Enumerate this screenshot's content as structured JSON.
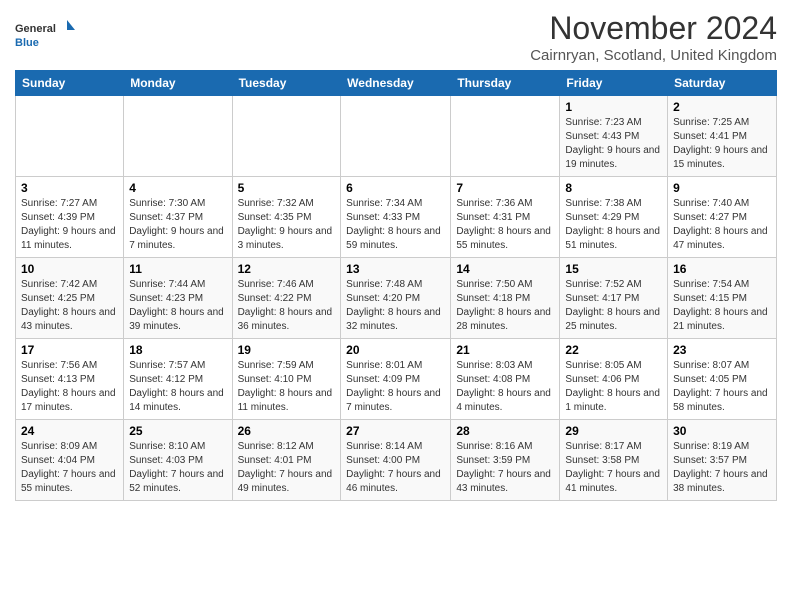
{
  "header": {
    "logo_line1": "General",
    "logo_line2": "Blue",
    "title": "November 2024",
    "subtitle": "Cairnryan, Scotland, United Kingdom"
  },
  "days_of_week": [
    "Sunday",
    "Monday",
    "Tuesday",
    "Wednesday",
    "Thursday",
    "Friday",
    "Saturday"
  ],
  "weeks": [
    [
      {
        "day": "",
        "info": ""
      },
      {
        "day": "",
        "info": ""
      },
      {
        "day": "",
        "info": ""
      },
      {
        "day": "",
        "info": ""
      },
      {
        "day": "",
        "info": ""
      },
      {
        "day": "1",
        "info": "Sunrise: 7:23 AM\nSunset: 4:43 PM\nDaylight: 9 hours and 19 minutes."
      },
      {
        "day": "2",
        "info": "Sunrise: 7:25 AM\nSunset: 4:41 PM\nDaylight: 9 hours and 15 minutes."
      }
    ],
    [
      {
        "day": "3",
        "info": "Sunrise: 7:27 AM\nSunset: 4:39 PM\nDaylight: 9 hours and 11 minutes."
      },
      {
        "day": "4",
        "info": "Sunrise: 7:30 AM\nSunset: 4:37 PM\nDaylight: 9 hours and 7 minutes."
      },
      {
        "day": "5",
        "info": "Sunrise: 7:32 AM\nSunset: 4:35 PM\nDaylight: 9 hours and 3 minutes."
      },
      {
        "day": "6",
        "info": "Sunrise: 7:34 AM\nSunset: 4:33 PM\nDaylight: 8 hours and 59 minutes."
      },
      {
        "day": "7",
        "info": "Sunrise: 7:36 AM\nSunset: 4:31 PM\nDaylight: 8 hours and 55 minutes."
      },
      {
        "day": "8",
        "info": "Sunrise: 7:38 AM\nSunset: 4:29 PM\nDaylight: 8 hours and 51 minutes."
      },
      {
        "day": "9",
        "info": "Sunrise: 7:40 AM\nSunset: 4:27 PM\nDaylight: 8 hours and 47 minutes."
      }
    ],
    [
      {
        "day": "10",
        "info": "Sunrise: 7:42 AM\nSunset: 4:25 PM\nDaylight: 8 hours and 43 minutes."
      },
      {
        "day": "11",
        "info": "Sunrise: 7:44 AM\nSunset: 4:23 PM\nDaylight: 8 hours and 39 minutes."
      },
      {
        "day": "12",
        "info": "Sunrise: 7:46 AM\nSunset: 4:22 PM\nDaylight: 8 hours and 36 minutes."
      },
      {
        "day": "13",
        "info": "Sunrise: 7:48 AM\nSunset: 4:20 PM\nDaylight: 8 hours and 32 minutes."
      },
      {
        "day": "14",
        "info": "Sunrise: 7:50 AM\nSunset: 4:18 PM\nDaylight: 8 hours and 28 minutes."
      },
      {
        "day": "15",
        "info": "Sunrise: 7:52 AM\nSunset: 4:17 PM\nDaylight: 8 hours and 25 minutes."
      },
      {
        "day": "16",
        "info": "Sunrise: 7:54 AM\nSunset: 4:15 PM\nDaylight: 8 hours and 21 minutes."
      }
    ],
    [
      {
        "day": "17",
        "info": "Sunrise: 7:56 AM\nSunset: 4:13 PM\nDaylight: 8 hours and 17 minutes."
      },
      {
        "day": "18",
        "info": "Sunrise: 7:57 AM\nSunset: 4:12 PM\nDaylight: 8 hours and 14 minutes."
      },
      {
        "day": "19",
        "info": "Sunrise: 7:59 AM\nSunset: 4:10 PM\nDaylight: 8 hours and 11 minutes."
      },
      {
        "day": "20",
        "info": "Sunrise: 8:01 AM\nSunset: 4:09 PM\nDaylight: 8 hours and 7 minutes."
      },
      {
        "day": "21",
        "info": "Sunrise: 8:03 AM\nSunset: 4:08 PM\nDaylight: 8 hours and 4 minutes."
      },
      {
        "day": "22",
        "info": "Sunrise: 8:05 AM\nSunset: 4:06 PM\nDaylight: 8 hours and 1 minute."
      },
      {
        "day": "23",
        "info": "Sunrise: 8:07 AM\nSunset: 4:05 PM\nDaylight: 7 hours and 58 minutes."
      }
    ],
    [
      {
        "day": "24",
        "info": "Sunrise: 8:09 AM\nSunset: 4:04 PM\nDaylight: 7 hours and 55 minutes."
      },
      {
        "day": "25",
        "info": "Sunrise: 8:10 AM\nSunset: 4:03 PM\nDaylight: 7 hours and 52 minutes."
      },
      {
        "day": "26",
        "info": "Sunrise: 8:12 AM\nSunset: 4:01 PM\nDaylight: 7 hours and 49 minutes."
      },
      {
        "day": "27",
        "info": "Sunrise: 8:14 AM\nSunset: 4:00 PM\nDaylight: 7 hours and 46 minutes."
      },
      {
        "day": "28",
        "info": "Sunrise: 8:16 AM\nSunset: 3:59 PM\nDaylight: 7 hours and 43 minutes."
      },
      {
        "day": "29",
        "info": "Sunrise: 8:17 AM\nSunset: 3:58 PM\nDaylight: 7 hours and 41 minutes."
      },
      {
        "day": "30",
        "info": "Sunrise: 8:19 AM\nSunset: 3:57 PM\nDaylight: 7 hours and 38 minutes."
      }
    ]
  ]
}
